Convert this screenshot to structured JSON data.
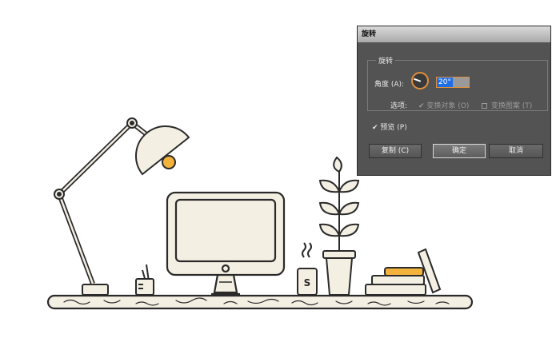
{
  "dialog": {
    "title": "旋转",
    "group_title": "旋转",
    "angle_label": "角度 (A):",
    "angle_value": "20°",
    "options_label": "选项:",
    "option_transform_objects": "变换对象 (O)",
    "option_transform_patterns": "变换图案 (T)",
    "preview_label": "预览 (P)",
    "copy_button": "复制 (C)",
    "ok_button": "确定",
    "cancel_button": "取消",
    "preview_checked": true,
    "transform_objects_checked": true,
    "transform_patterns_checked": false
  },
  "illustration": {
    "mug_letter": "S"
  },
  "colors": {
    "line": "#2a2a2a",
    "cream": "#f4efe3",
    "accent_yellow": "#f3b23b",
    "dialog_bg": "#535353",
    "angle_highlight": "#1e6ee8",
    "orange_border": "#e0903a"
  },
  "icons": {
    "preview_check": "✔",
    "objects_check": "✔"
  }
}
